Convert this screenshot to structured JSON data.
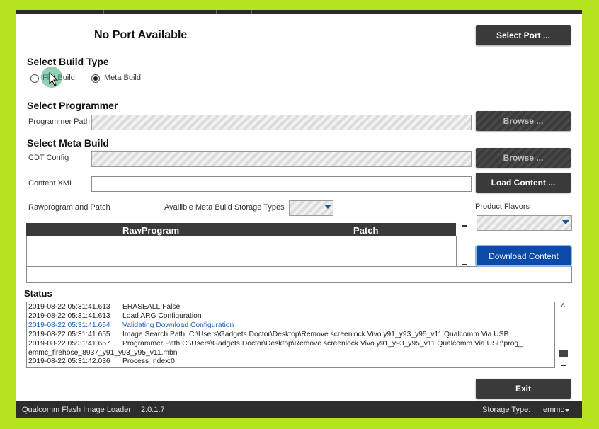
{
  "header": {
    "port_status": "No Port Available",
    "select_port_label": "Select Port ..."
  },
  "build_type": {
    "heading": "Select Build Type",
    "options": [
      "Flat Build",
      "Meta Build"
    ],
    "selected": "Meta Build"
  },
  "programmer": {
    "heading": "Select Programmer",
    "path_label": "Programmer Path",
    "path_value": "",
    "browse_label": "Browse ..."
  },
  "meta_build": {
    "heading": "Select Meta Build",
    "cdt_label": "CDT Config",
    "cdt_value": "",
    "browse_label": "Browse ...",
    "content_xml_label": "Content XML",
    "content_xml_value": "",
    "load_content_label": "Load Content ...",
    "rawprogram_label": "Rawprogram and Patch",
    "storage_types_label": "Availible Meta Build Storage Types",
    "storage_type_value": "",
    "product_flavors_label": "Product Flavors",
    "product_flavor_value": ""
  },
  "table": {
    "columns": [
      "RawProgram",
      "Patch"
    ],
    "rows": []
  },
  "download_label": "Download Content",
  "status": {
    "heading": "Status",
    "log": [
      {
        "time": "2019-08-22 05:31:41.613",
        "msg": "ERASEALL:False",
        "highlight": false
      },
      {
        "time": "2019-08-22 05:31:41.613",
        "msg": "Load ARG Configuration",
        "highlight": false
      },
      {
        "time": "2019-08-22 05:31:41.654",
        "msg": "Validating Download Configuration",
        "highlight": true
      },
      {
        "time": "2019-08-22 05:31:41.655",
        "msg": "Image Search Path: C:\\Users\\Gadgets Doctor\\Desktop\\Remove screenlock Vivo y91_y93_y95_v11 Qualcomm Via USB",
        "highlight": false
      },
      {
        "time": "2019-08-22 05:31:41.657",
        "msg": "Programmer Path:C:\\Users\\Gadgets Doctor\\Desktop\\Remove screenlock Vivo y91_y93_y95_v11 Qualcomm Via USB\\prog_",
        "highlight": false
      },
      {
        "time": "",
        "msg": "emmc_firehose_8937_y91_y93_y95_v11.mbn",
        "highlight": false
      },
      {
        "time": "2019-08-22 05:31:42.036",
        "msg": "Process Index:0",
        "highlight": false
      }
    ]
  },
  "exit_label": "Exit",
  "statusbar": {
    "app_name": "Qualcomm Flash Image Loader",
    "version": "2.0.1.7",
    "storage_label": "Storage Type:",
    "storage_value": "emmc"
  },
  "colors": {
    "frame_green": "#b6e31f",
    "dark_button": "#3a3a3a",
    "blue_button": "#0b4aa6",
    "log_highlight": "#1a5fb4"
  }
}
